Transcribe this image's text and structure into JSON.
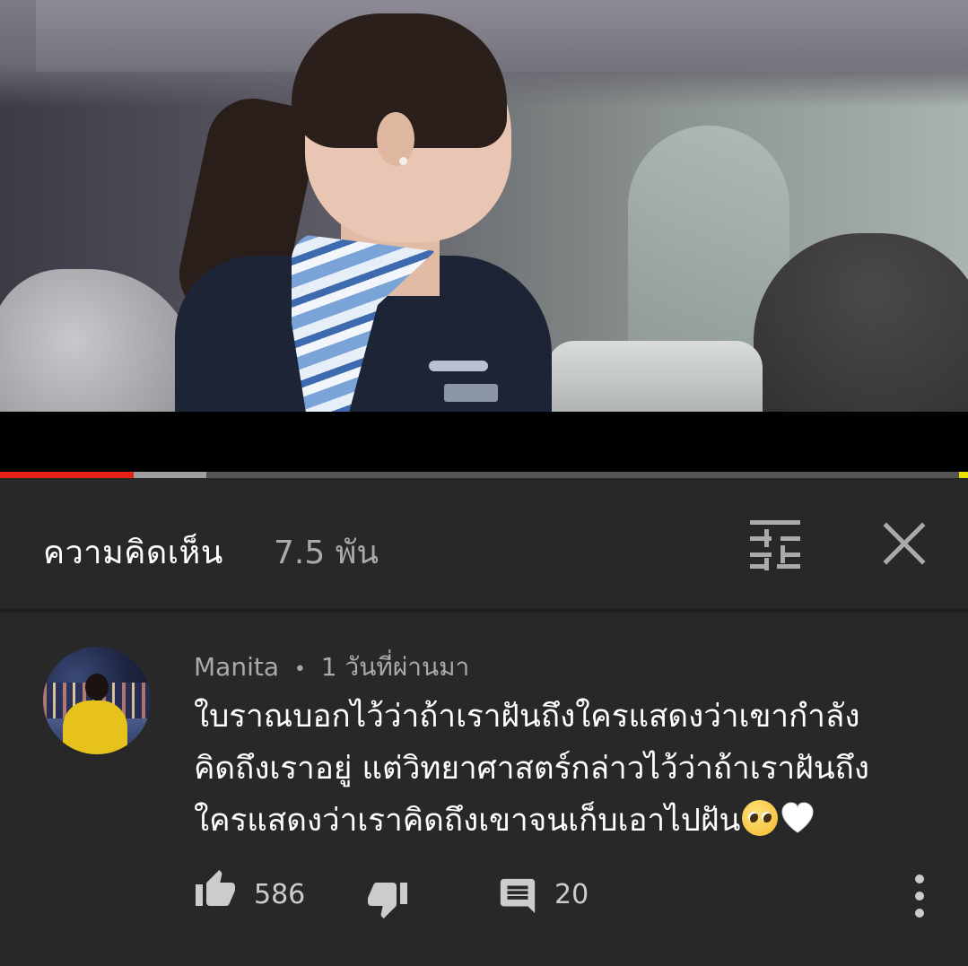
{
  "video": {
    "progress_played_fraction": 0.138,
    "progress_buffered_fraction": 0.213
  },
  "comments_panel": {
    "title": "ความคิดเห็น",
    "count": "7.5 พัน",
    "filter_icon": "sort-sliders-icon",
    "close_icon": "close-icon"
  },
  "comment": {
    "author": "Manita",
    "separator": "•",
    "time": "1 วันที่ผ่านมา",
    "text_lines": [
      "ใบราณบอกไว้ว่าถ้าเราฝันถึงใครแสดงว่าเขากำลัง",
      "คิดถึงเราอยู่ แต่วิทยาศาสตร์กล่าวไว้ว่าถ้าเราฝันถึง",
      "ใครแสดงว่าเราคิดถึงเขาจนเก็บเอาไปฝัน"
    ],
    "emojis": [
      "🥺",
      "🤍"
    ],
    "likes": "586",
    "replies": "20",
    "like_icon": "thumbs-up-icon",
    "dislike_icon": "thumbs-down-icon",
    "reply_icon": "reply-comment-icon",
    "more_icon": "more-vertical-icon"
  },
  "colors": {
    "background": "#282828",
    "progress_played": "#e62117",
    "progress_buffered": "#9e9e9e",
    "text_secondary": "#aaaaaa"
  }
}
